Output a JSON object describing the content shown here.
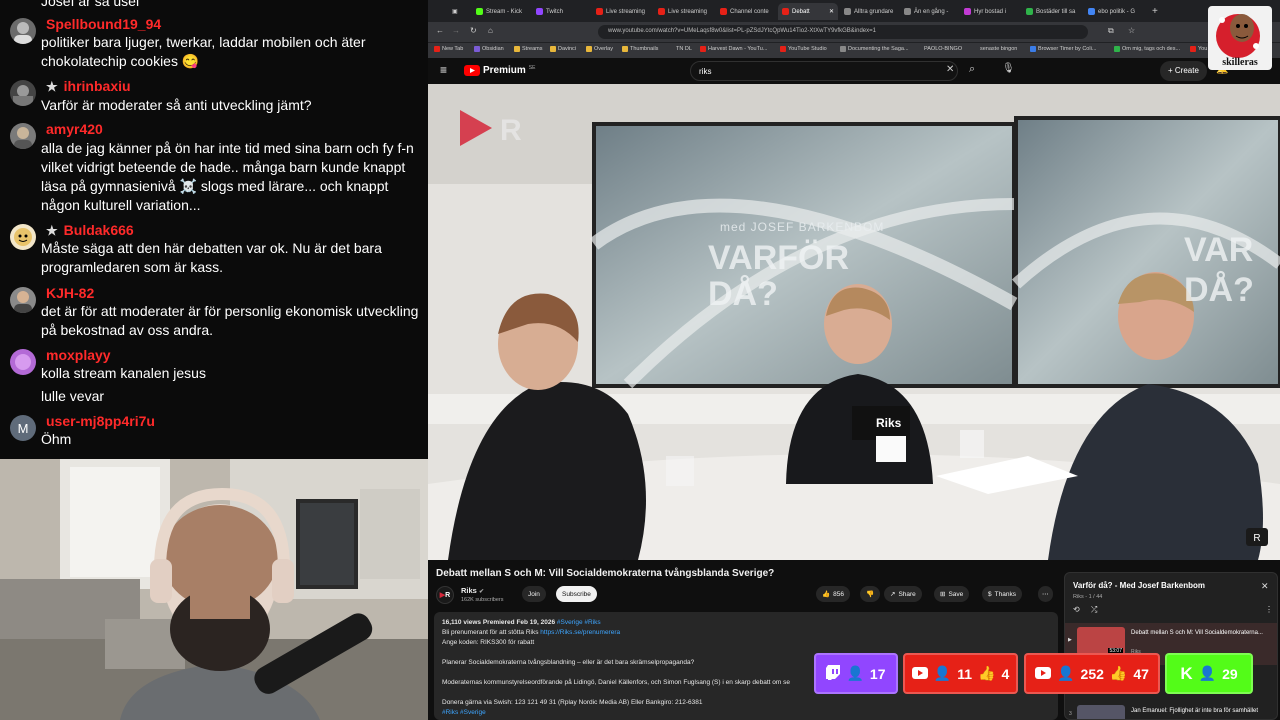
{
  "chat": {
    "messages": [
      {
        "user": "",
        "text": "Josef är så usel",
        "star": false
      },
      {
        "user": "Spellbound19_94",
        "text": "politiker bara ljuger, twerkar, laddar mobilen och äter chokolatechip cookies 😋",
        "star": false
      },
      {
        "user": "ihrinbaxiu",
        "text": "Varför är moderater så anti utveckling jämt?",
        "star": true
      },
      {
        "user": "amyr420",
        "text": "alla de jag känner på ön har inte tid med sina barn och fy f-n vilket vidrigt beteende de hade.. många barn kunde knappt läsa på gymnasienivå ☠️ slogs med lärare... och knappt någon kulturell variation...",
        "star": false
      },
      {
        "user": "Buldak666",
        "text": "Måste säga att den här debatten var ok. Nu är det bara programledaren som är kass.",
        "star": true
      },
      {
        "user": "KJH-82",
        "text": "det är för att moderater är för personlig ekonomisk utveckling på bekostnad av oss andra.",
        "star": false
      },
      {
        "user": "moxplayy",
        "text": "kolla stream kanalen jesus",
        "star": false
      },
      {
        "user": "",
        "text": "lulle vevar",
        "star": false
      },
      {
        "user": "user-mj8pp4ri7u",
        "text": "Öhm",
        "star": false,
        "avatar_letter": "M"
      }
    ]
  },
  "browser": {
    "tabs": [
      "Stream - Kick",
      "Twitch",
      "Live streaming",
      "Live streaming",
      "Channel conte",
      "Debatt",
      "Alltra grundare",
      "Än en gång -",
      "Hyr bostad i",
      "Bostäder till sa",
      "ebo politik - G"
    ],
    "active_tab": 5,
    "url": "www.youtube.com/watch?v=UMeLaqsf8w0&list=PL-pZSdJYtcQpWu14Tio2-XtXwTY9vfkGB&index=1",
    "bookmarks": [
      "New Tab",
      "Obsidian",
      "Streams",
      "Davinci",
      "Overlay",
      "Thumbnails",
      "TN DL",
      "Harvest Dawn - YouTu...",
      "YouTube Studio",
      "Documenting the Saga...",
      "PAOLO-BINGO",
      "senaste bingon",
      "Browser Timer by Coli...",
      "Om mig, tags och des...",
      "You"
    ]
  },
  "youtube": {
    "brand": "Premium",
    "brand_sup": "SE",
    "search_value": "riks",
    "create_label": "Create",
    "video_overlay_host": "med JOSEF BARKENBOM",
    "video_overlay_title": "VARFÖR DÅ?",
    "video_overlay_title_right": "VAR DÅ?",
    "video_prop_label": "Riks",
    "title": "Debatt mellan S och M: Vill Socialdemokraterna tvångsblanda Sverige?",
    "channel": "Riks",
    "subscribers": "162K subscribers",
    "join_label": "Join",
    "subscribe_label": "Subscribe",
    "likes": "856",
    "share_label": "Share",
    "save_label": "Save",
    "thanks_label": "Thanks",
    "desc_meta": "16,110 views  Premiered Feb 19, 2026",
    "desc_tags": "#Sverige #Riks",
    "desc_line1": "Bli prenumerant för att stötta Riks",
    "desc_link1": "https://Riks.se/prenumerera",
    "desc_line2": "Ange koden: RIKS300 för rabatt",
    "desc_line3": "Planerar Socialdemokraterna tvångsblandning – eller är det bara skrämselpropaganda?",
    "desc_line4": "Moderaternas kommunstyrelseordförande på Lidingö, Daniel Källenfors, och Simon Fuglsang (S) i en skarp debatt om se",
    "desc_line5": "Donera gärna via Swish: 123 121 49 31 (Rplay Nordic Media AB) Eller Bankgiro: 212-6381",
    "desc_tags2": "#Riks #Sverige",
    "playlist_title": "Varför då? - Med Josef Barkenbom",
    "playlist_sub": "Riks - 1 / 44",
    "playlist_items": [
      {
        "title": "Debatt mellan S och M: Vill Socialdemokraterna...",
        "channel": "Riks",
        "duration": "53:07"
      },
      {
        "title": "Jan Emanuel: Fjollighet är inte bra för samhället",
        "channel": "",
        "duration": ""
      }
    ],
    "playlist_item_index": "3"
  },
  "counters": {
    "twitch": "17",
    "youtube1_viewers": "11",
    "youtube1_likes": "4",
    "youtube2_viewers": "252",
    "youtube2_likes": "47",
    "kick": "29",
    "colors": {
      "twitch": "#9146ff",
      "youtube": "#e62117",
      "kick": "#53fc18"
    }
  },
  "logo_text": "skilleras"
}
